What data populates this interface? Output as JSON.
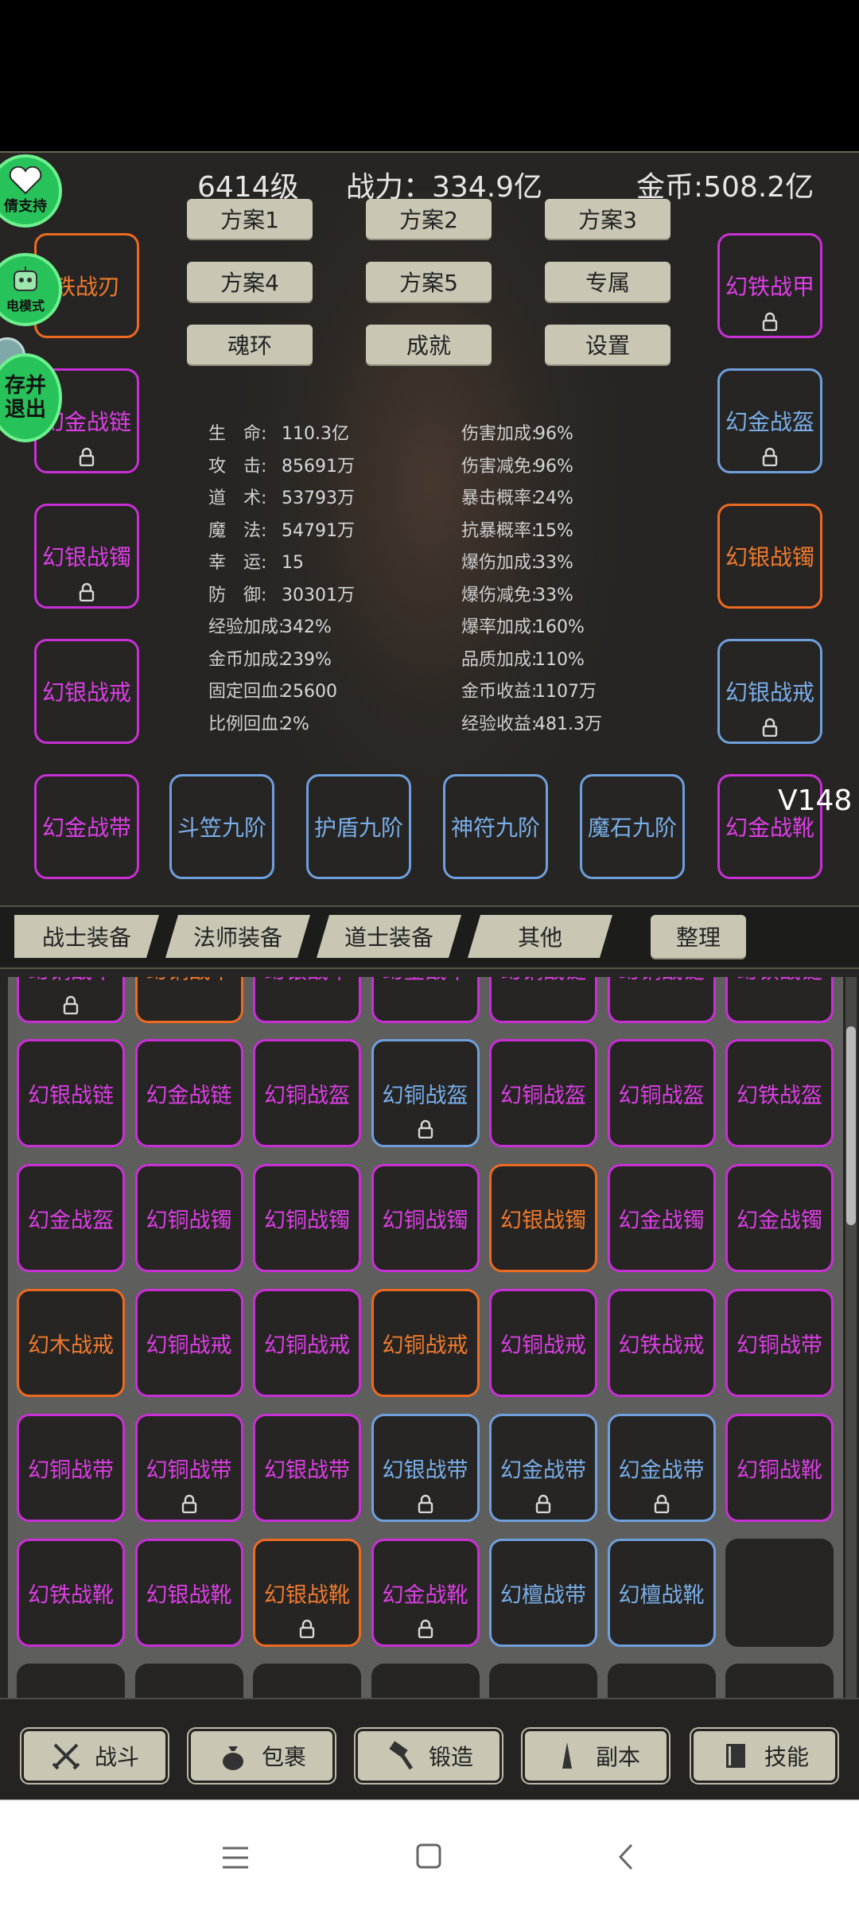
{
  "header": {
    "level": "6414级",
    "power": "战力：334.9亿",
    "gold": "金币:508.2亿"
  },
  "side_buttons": {
    "support": "倩支持",
    "power_mode": "电模式",
    "save_exit_line1": "存并",
    "save_exit_line2": "退出"
  },
  "menu_buttons": [
    "方案1",
    "方案2",
    "方案3",
    "方案4",
    "方案5",
    "专属",
    "魂环",
    "成就",
    "设置"
  ],
  "left_equip": [
    {
      "label": "铁战刃",
      "tier": "o",
      "locked": false
    },
    {
      "label": "幻金战链",
      "tier": "p",
      "locked": true
    },
    {
      "label": "幻银战镯",
      "tier": "p",
      "locked": true
    },
    {
      "label": "幻银战戒",
      "tier": "p",
      "locked": false
    },
    {
      "label": "幻金战带",
      "tier": "p",
      "locked": false
    }
  ],
  "right_equip": [
    {
      "label": "幻铁战甲",
      "tier": "p",
      "locked": true
    },
    {
      "label": "幻金战盔",
      "tier": "b",
      "locked": true
    },
    {
      "label": "幻银战镯",
      "tier": "o",
      "locked": false
    },
    {
      "label": "幻银战戒",
      "tier": "b",
      "locked": true
    },
    {
      "label": "幻金战靴",
      "tier": "p",
      "locked": false
    }
  ],
  "bottom_equip": [
    {
      "label": "斗笠九阶",
      "tier": "b"
    },
    {
      "label": "护盾九阶",
      "tier": "b"
    },
    {
      "label": "神符九阶",
      "tier": "b"
    },
    {
      "label": "魔石九阶",
      "tier": "b"
    }
  ],
  "version": "V148",
  "stats_left": [
    {
      "label": "生　命:",
      "value": "110.3亿"
    },
    {
      "label": "攻　击:",
      "value": "85691万"
    },
    {
      "label": "道　术:",
      "value": "53793万"
    },
    {
      "label": "魔　法:",
      "value": "54791万"
    },
    {
      "label": "幸　运:",
      "value": "15"
    },
    {
      "label": "防　御:",
      "value": "30301万"
    },
    {
      "label": "经验加成:",
      "value": "342%"
    },
    {
      "label": "金币加成:",
      "value": "239%"
    },
    {
      "label": "固定回血:",
      "value": "25600"
    },
    {
      "label": "比例回血:",
      "value": "2%"
    }
  ],
  "stats_right": [
    {
      "label": "伤害加成:",
      "value": "96%"
    },
    {
      "label": "伤害减免:",
      "value": "96%"
    },
    {
      "label": "暴击概率:",
      "value": "24%"
    },
    {
      "label": "抗暴概率:",
      "value": "15%"
    },
    {
      "label": "爆伤加成:",
      "value": "33%"
    },
    {
      "label": "爆伤减免:",
      "value": "33%"
    },
    {
      "label": "爆率加成:",
      "value": "160%"
    },
    {
      "label": "品质加成:",
      "value": "110%"
    },
    {
      "label": "金币收益:",
      "value": "1107万"
    },
    {
      "label": "经验收益:",
      "value": "481.3万"
    }
  ],
  "tabs": [
    "战士装备",
    "法师装备",
    "道士装备",
    "其他"
  ],
  "sort_button": "整理",
  "inventory": [
    [
      {
        "l": "幻铜战甲",
        "t": "p",
        "k": true
      },
      {
        "l": "幻铜战甲",
        "t": "o",
        "k": false
      },
      {
        "l": "幻银战甲",
        "t": "p",
        "k": false
      },
      {
        "l": "幻金战甲",
        "t": "p",
        "k": false
      },
      {
        "l": "幻铜战链",
        "t": "p",
        "k": false
      },
      {
        "l": "幻铜战链",
        "t": "p",
        "k": false
      },
      {
        "l": "幻铁战链",
        "t": "p",
        "k": false
      }
    ],
    [
      {
        "l": "幻银战链",
        "t": "p",
        "k": false
      },
      {
        "l": "幻金战链",
        "t": "p",
        "k": false
      },
      {
        "l": "幻铜战盔",
        "t": "p",
        "k": false
      },
      {
        "l": "幻铜战盔",
        "t": "b",
        "k": true
      },
      {
        "l": "幻铜战盔",
        "t": "p",
        "k": false
      },
      {
        "l": "幻铜战盔",
        "t": "p",
        "k": false
      },
      {
        "l": "幻铁战盔",
        "t": "p",
        "k": false
      }
    ],
    [
      {
        "l": "幻金战盔",
        "t": "p",
        "k": false
      },
      {
        "l": "幻铜战镯",
        "t": "p",
        "k": false
      },
      {
        "l": "幻铜战镯",
        "t": "p",
        "k": false
      },
      {
        "l": "幻铜战镯",
        "t": "p",
        "k": false
      },
      {
        "l": "幻银战镯",
        "t": "o",
        "k": false
      },
      {
        "l": "幻金战镯",
        "t": "p",
        "k": false
      },
      {
        "l": "幻金战镯",
        "t": "p",
        "k": false
      }
    ],
    [
      {
        "l": "幻木战戒",
        "t": "o",
        "k": false
      },
      {
        "l": "幻铜战戒",
        "t": "p",
        "k": false
      },
      {
        "l": "幻铜战戒",
        "t": "p",
        "k": false
      },
      {
        "l": "幻铜战戒",
        "t": "o",
        "k": false
      },
      {
        "l": "幻铜战戒",
        "t": "p",
        "k": false
      },
      {
        "l": "幻铁战戒",
        "t": "p",
        "k": false
      },
      {
        "l": "幻铜战带",
        "t": "p",
        "k": false
      }
    ],
    [
      {
        "l": "幻铜战带",
        "t": "p",
        "k": false
      },
      {
        "l": "幻铜战带",
        "t": "p",
        "k": true
      },
      {
        "l": "幻银战带",
        "t": "p",
        "k": false
      },
      {
        "l": "幻银战带",
        "t": "b",
        "k": true
      },
      {
        "l": "幻金战带",
        "t": "b",
        "k": true
      },
      {
        "l": "幻金战带",
        "t": "b",
        "k": true
      },
      {
        "l": "幻铜战靴",
        "t": "p",
        "k": false
      }
    ],
    [
      {
        "l": "幻铁战靴",
        "t": "p",
        "k": false
      },
      {
        "l": "幻银战靴",
        "t": "p",
        "k": false
      },
      {
        "l": "幻银战靴",
        "t": "o",
        "k": true
      },
      {
        "l": "幻金战靴",
        "t": "p",
        "k": true
      },
      {
        "l": "幻檀战带",
        "t": "b",
        "k": false
      },
      {
        "l": "幻檀战靴",
        "t": "b",
        "k": false
      },
      {
        "l": "",
        "t": "e",
        "k": false
      }
    ]
  ],
  "bottom_nav": [
    {
      "label": "战斗",
      "icon": "swords-icon"
    },
    {
      "label": "包裹",
      "icon": "bag-icon"
    },
    {
      "label": "锻造",
      "icon": "hammer-icon"
    },
    {
      "label": "副本",
      "icon": "tower-icon"
    },
    {
      "label": "技能",
      "icon": "book-icon"
    }
  ],
  "system_nav": [
    "menu-icon",
    "home-icon",
    "back-icon"
  ]
}
